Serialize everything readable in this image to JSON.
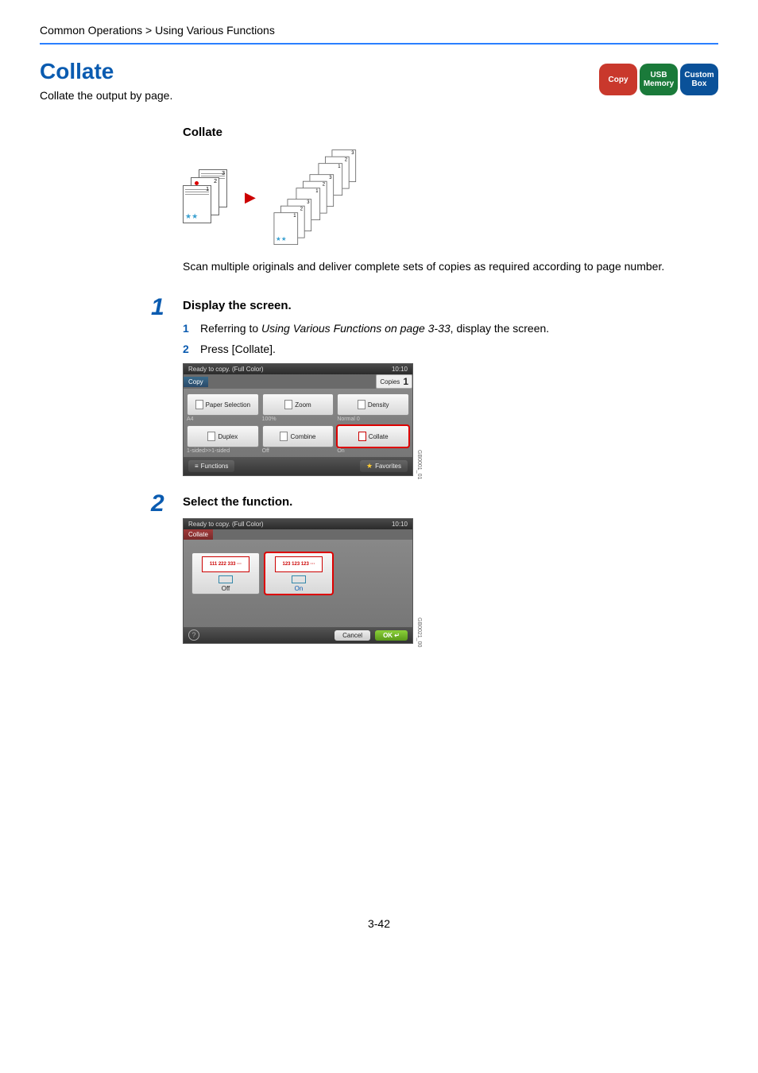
{
  "breadcrumb": "Common Operations > Using Various Functions",
  "title": "Collate",
  "subtitle": "Collate the output by page.",
  "badges": {
    "copy": "Copy",
    "usb_line1": "USB",
    "usb_line2": "Memory",
    "box_line1": "Custom",
    "box_line2": "Box"
  },
  "diagram": {
    "heading": "Collate"
  },
  "description": "Scan multiple originals and deliver complete sets of copies as required according to page number.",
  "step1": {
    "num": "1",
    "title": "Display the screen.",
    "sub1_num": "1",
    "sub1_pre": "Referring to ",
    "sub1_em": "Using Various Functions on page 3-33",
    "sub1_post": ", display the screen.",
    "sub2_num": "2",
    "sub2_text": "Press [Collate]."
  },
  "panel1": {
    "status": "Ready to copy. (Full Color)",
    "time": "10:10",
    "tab": "Copy",
    "copies_label": "Copies",
    "copies_value": "1",
    "btn_paper": "Paper Selection",
    "btn_paper_sub": "A4",
    "btn_zoom": "Zoom",
    "btn_zoom_sub": "100%",
    "btn_density": "Density",
    "btn_density_sub": "Normal 0",
    "btn_duplex": "Duplex",
    "btn_duplex_sub": "1-sided>>1-sided",
    "btn_combine": "Combine",
    "btn_combine_sub": "Off",
    "btn_collate": "Collate",
    "btn_collate_sub": "On",
    "foot_functions": "Functions",
    "foot_favorites": "Favorites",
    "side_label": "GB0001_01"
  },
  "step2": {
    "num": "2",
    "title": "Select the function."
  },
  "panel2": {
    "status": "Ready to copy. (Full Color)",
    "time": "10:10",
    "tab": "Collate",
    "opt_off_icon": "111 222 333 ···",
    "opt_off_label": "Off",
    "opt_on_icon": "123 123 123 ···",
    "opt_on_label": "On",
    "cancel": "Cancel",
    "ok": "OK",
    "help": "?",
    "side_label": "GB0021_00"
  },
  "page_number": "3-42"
}
